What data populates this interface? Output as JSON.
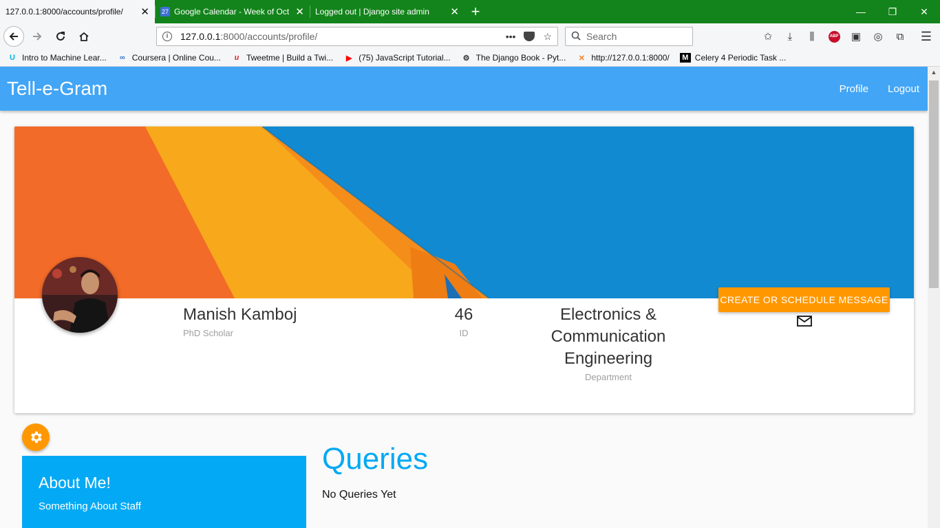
{
  "browser": {
    "tabs": [
      {
        "title": "127.0.0.1:8000/accounts/profile/",
        "favicon": "",
        "active": true
      },
      {
        "title": "Google Calendar - Week of Oct",
        "favicon": "27",
        "active": false
      },
      {
        "title": "Logged out | Django site admin",
        "favicon": "",
        "active": false
      }
    ],
    "new_tab": "+",
    "url_host": "127.0.0.1",
    "url_rest": ":8000/accounts/profile/",
    "url_more": "•••",
    "search_placeholder": "Search",
    "bookmarks": [
      {
        "label": "Intro to Machine Lear...",
        "icon": "U",
        "color": "#02b3e4"
      },
      {
        "label": "Coursera | Online Cou...",
        "icon": "∞",
        "color": "#2a73cc"
      },
      {
        "label": "Tweetme | Build a Twi...",
        "icon": "u",
        "color": "#d9252a"
      },
      {
        "label": "(75) JavaScript Tutorial...",
        "icon": "▶",
        "color": "#ff0000"
      },
      {
        "label": "The Django Book - Pyt...",
        "icon": "⚙",
        "color": "#333333"
      },
      {
        "label": "http://127.0.0.1:8000/",
        "icon": "✕",
        "color": "#f48024"
      },
      {
        "label": "Celery 4 Periodic Task ...",
        "icon": "M",
        "color": "#000000"
      }
    ]
  },
  "app": {
    "brand": "Tell-e-Gram",
    "nav": {
      "profile": "Profile",
      "logout": "Logout"
    }
  },
  "profile": {
    "name": "Manish Kamboj",
    "role": "PhD Scholar",
    "id_value": "46",
    "id_label": "ID",
    "department_value": "Electronics & Communication Engineering",
    "department_label": "Department",
    "message_button": "CREATE OR SCHEDULE MESSAGE"
  },
  "about": {
    "title": "About Me!",
    "text": "Something About Staff"
  },
  "queries": {
    "title": "Queries",
    "empty_text": "No Queries Yet"
  },
  "colors": {
    "appbar": "#42a5f5",
    "accent": "#ff9800",
    "about_bg": "#03a9f4",
    "tabbar": "#13841b"
  }
}
